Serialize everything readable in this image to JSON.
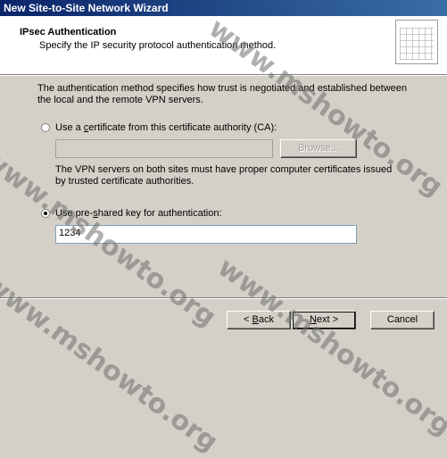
{
  "window": {
    "title": "New Site-to-Site Network Wizard"
  },
  "header": {
    "title": "IPsec Authentication",
    "subtitle": "Specify the IP security protocol authentication method."
  },
  "description": "The authentication method specifies how trust is negotiated and established between the local and the remote VPN servers.",
  "certificate_option": {
    "label_pre": "Use a ",
    "label_accel": "c",
    "label_post": "ertificate from this certificate authority (CA):",
    "selected": false,
    "input_value": "",
    "browse_label": "Browse...",
    "note": "The VPN servers on both sites must have proper computer certificates issued by trusted certificate authorities."
  },
  "psk_option": {
    "label_pre": "Use pre-",
    "label_accel": "s",
    "label_post": "hared key for authentication:",
    "selected": true,
    "value": "1234"
  },
  "buttons": {
    "back_prefix": "< ",
    "back_accel": "B",
    "back_rest": "ack",
    "next_accel": "N",
    "next_rest": "ext >",
    "cancel": "Cancel"
  },
  "watermark": "www.mshowto.org"
}
